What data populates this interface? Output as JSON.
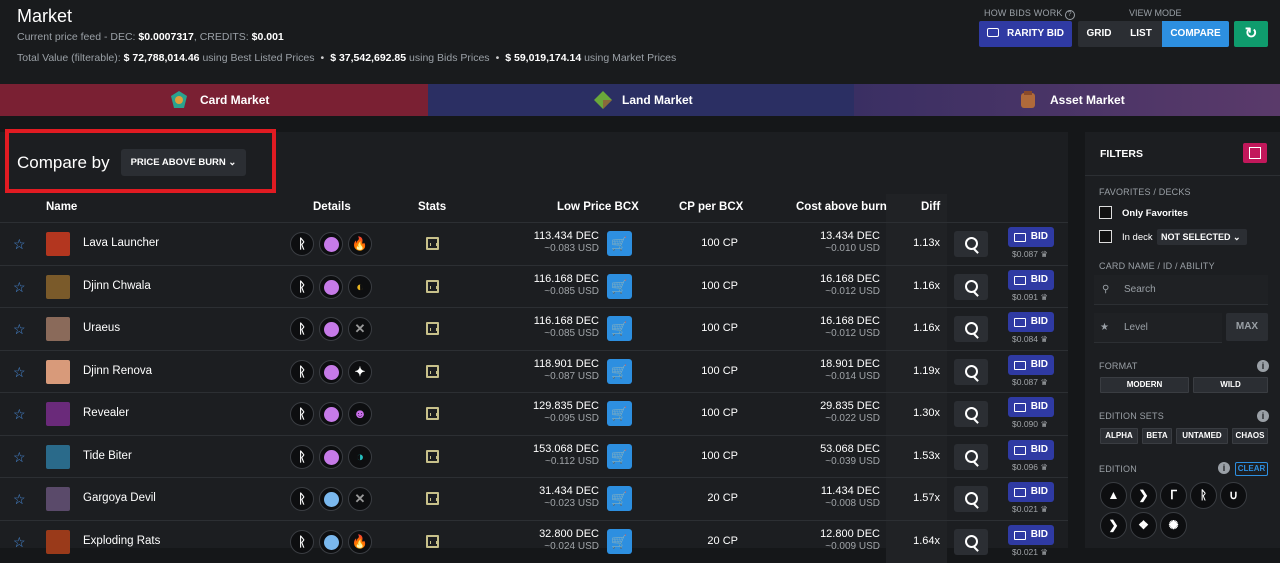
{
  "header": {
    "title": "Market",
    "price_feed_prefix": "Current price feed - DEC:",
    "dec_price": "$0.0007317",
    "credits_label": ", CREDITS:",
    "credits_price": "$0.001",
    "total_prefix": "Total Value (filterable):",
    "total_best": "$ 72,788,014.46",
    "best_suffix": "using Best Listed Prices",
    "total_bids": "$ 37,542,692.85",
    "bids_suffix": "using Bids Prices",
    "total_market": "$ 59,019,174.14",
    "market_suffix": "using Market Prices",
    "how_bids_label": "HOW BIDS WORK",
    "view_mode_label": "VIEW MODE",
    "rarity_bid": "RARITY BID",
    "view_grid": "GRID",
    "view_list": "LIST",
    "view_compare": "COMPARE",
    "refresh_icon": "↻"
  },
  "tabs": [
    {
      "label": "Card Market",
      "color": "#7a2033"
    },
    {
      "label": "Land Market",
      "color": "#2b2f63"
    },
    {
      "label": "Asset Market",
      "color": "#4a3568"
    }
  ],
  "compare": {
    "label": "Compare by",
    "select": "PRICE ABOVE BURN ⌄"
  },
  "columns": {
    "name": "Name",
    "details": "Details",
    "stats": "Stats",
    "low_price": "Low Price BCX",
    "cp": "CP per BCX",
    "cost": "Cost above burn",
    "diff": "Diff"
  },
  "rows": [
    {
      "name": "Lava Launcher",
      "rarity": "#c67ae8",
      "element": "fire",
      "low": "113.434 DEC",
      "low_usd": "~0.083 USD",
      "cp": "100 CP",
      "cost": "13.434 DEC",
      "cost_usd": "~0.010 USD",
      "diff": "1.13x",
      "bid": "BID",
      "bid_price": "$0.087 ♛",
      "avatar": "#b3361f"
    },
    {
      "name": "Djinn Chwala",
      "rarity": "#c67ae8",
      "element": "earth",
      "low": "116.168 DEC",
      "low_usd": "~0.085 USD",
      "cp": "100 CP",
      "cost": "16.168 DEC",
      "cost_usd": "~0.012 USD",
      "diff": "1.16x",
      "bid": "BID",
      "bid_price": "$0.091 ♛",
      "avatar": "#7a5a2a"
    },
    {
      "name": "Uraeus",
      "rarity": "#c67ae8",
      "element": "neutral",
      "low": "116.168 DEC",
      "low_usd": "~0.085 USD",
      "cp": "100 CP",
      "cost": "16.168 DEC",
      "cost_usd": "~0.012 USD",
      "diff": "1.16x",
      "bid": "BID",
      "bid_price": "$0.084 ♛",
      "avatar": "#8a6a5a"
    },
    {
      "name": "Djinn Renova",
      "rarity": "#c67ae8",
      "element": "life",
      "low": "118.901 DEC",
      "low_usd": "~0.087 USD",
      "cp": "100 CP",
      "cost": "18.901 DEC",
      "cost_usd": "~0.014 USD",
      "diff": "1.19x",
      "bid": "BID",
      "bid_price": "$0.087 ♛",
      "avatar": "#d89a7a"
    },
    {
      "name": "Revealer",
      "rarity": "#c67ae8",
      "element": "death",
      "low": "129.835 DEC",
      "low_usd": "~0.095 USD",
      "cp": "100 CP",
      "cost": "29.835 DEC",
      "cost_usd": "~0.022 USD",
      "diff": "1.30x",
      "bid": "BID",
      "bid_price": "$0.090 ♛",
      "avatar": "#6a2a7a"
    },
    {
      "name": "Tide Biter",
      "rarity": "#c67ae8",
      "element": "water",
      "low": "153.068 DEC",
      "low_usd": "~0.112 USD",
      "cp": "100 CP",
      "cost": "53.068 DEC",
      "cost_usd": "~0.039 USD",
      "diff": "1.53x",
      "bid": "BID",
      "bid_price": "$0.096 ♛",
      "avatar": "#2a6a8a"
    },
    {
      "name": "Gargoya Devil",
      "rarity": "#7ab8ee",
      "element": "neutral",
      "low": "31.434 DEC",
      "low_usd": "~0.023 USD",
      "cp": "20 CP",
      "cost": "11.434 DEC",
      "cost_usd": "~0.008 USD",
      "diff": "1.57x",
      "bid": "BID",
      "bid_price": "$0.021 ♛",
      "avatar": "#5a4a6a"
    },
    {
      "name": "Exploding Rats",
      "rarity": "#7ab8ee",
      "element": "fire",
      "low": "32.800 DEC",
      "low_usd": "~0.024 USD",
      "cp": "20 CP",
      "cost": "12.800 DEC",
      "cost_usd": "~0.009 USD",
      "diff": "1.64x",
      "bid": "BID",
      "bid_price": "$0.021 ♛",
      "avatar": "#9a3a1a"
    }
  ],
  "filters": {
    "title": "FILTERS",
    "favorites_label": "FAVORITES / DECKS",
    "only_favorites": "Only Favorites",
    "in_deck": "In deck",
    "not_selected": "NOT SELECTED ⌄",
    "card_name_label": "CARD NAME / ID / ABILITY",
    "search_placeholder": "Search",
    "level_placeholder": "Level",
    "max": "MAX",
    "format_label": "FORMAT",
    "modern": "MODERN",
    "wild": "WILD",
    "edition_sets_label": "EDITION SETS",
    "alpha": "ALPHA",
    "beta": "BETA",
    "untamed": "UNTAMED",
    "chaos": "CHAOS",
    "edition_label": "EDITION",
    "clear": "CLEAR"
  }
}
